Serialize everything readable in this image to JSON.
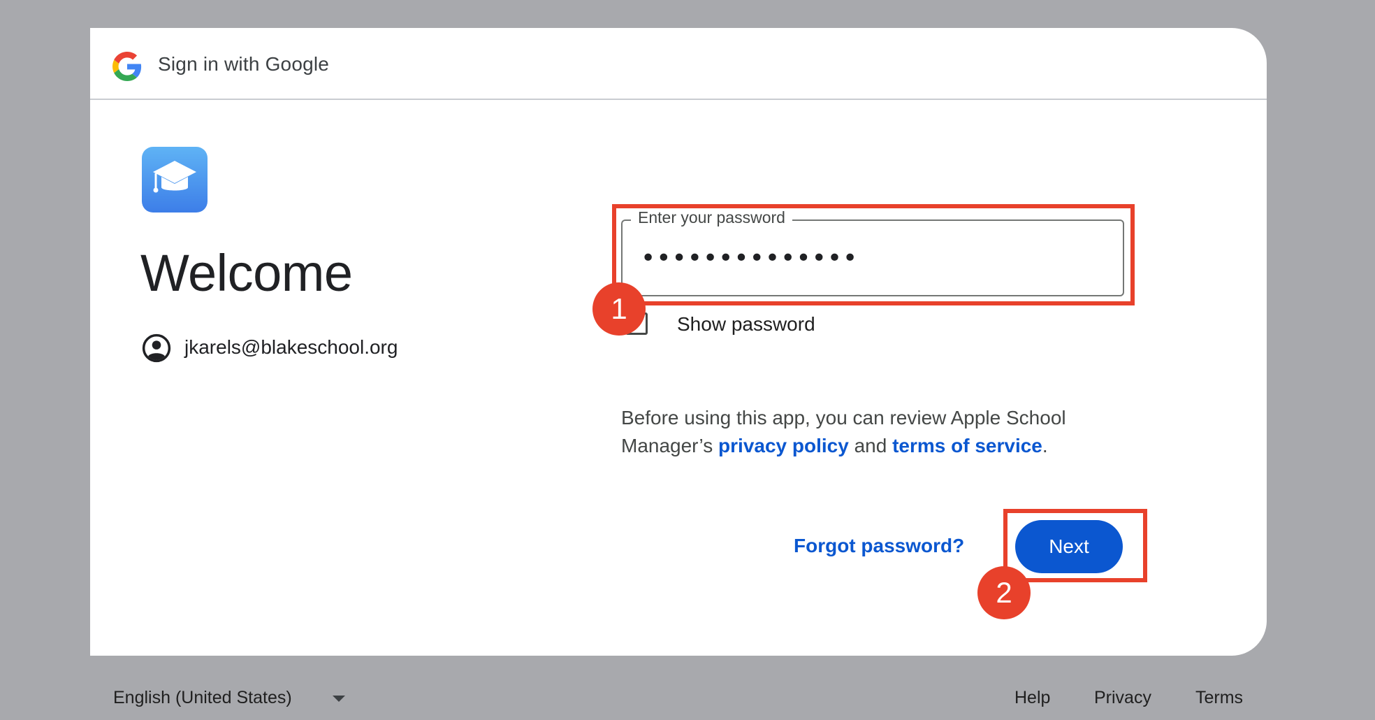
{
  "header": {
    "title": "Sign in with Google",
    "logo_icon": "google-g-icon"
  },
  "app": {
    "icon": "graduation-cap-icon",
    "icon_colors": [
      "#5fb3f5",
      "#3d7ee8"
    ]
  },
  "main": {
    "welcome": "Welcome",
    "account_icon": "account-circle-icon",
    "email": "jkarels@blakeschool.org"
  },
  "password": {
    "label": "Enter your password",
    "value": "••••••••••••••",
    "show_password_label": "Show password",
    "show_password_checked": false
  },
  "disclaimer": {
    "prefix": "Before using this app, you can review Apple School Manager’s ",
    "privacy_link": "privacy policy",
    "middle": " and ",
    "terms_link": "terms of service",
    "suffix": "."
  },
  "actions": {
    "forgot": "Forgot password?",
    "next": "Next"
  },
  "annotations": {
    "step1": "1",
    "step2": "2",
    "color": "#e8412b"
  },
  "footer": {
    "language": "English (United States)",
    "links": {
      "help": "Help",
      "privacy": "Privacy",
      "terms": "Terms"
    }
  },
  "colors": {
    "primary": "#0b57d0",
    "background": "#a8a9ad"
  }
}
